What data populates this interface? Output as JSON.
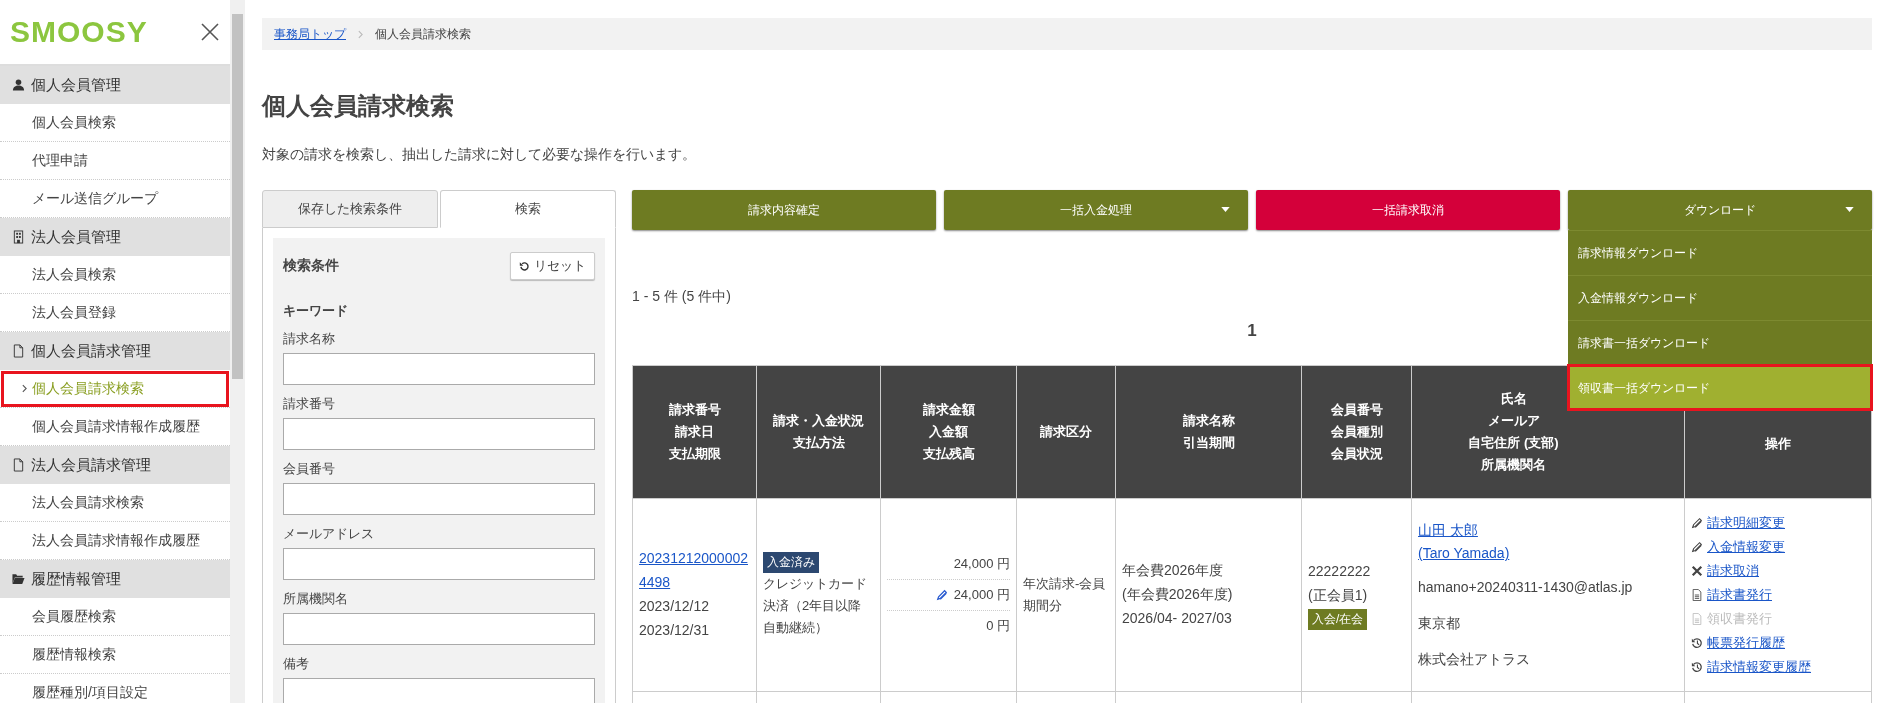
{
  "sidebar": {
    "logo": "SMOOSY",
    "sections": [
      {
        "title": "個人会員管理",
        "items": [
          {
            "label": "個人会員検索",
            "selected": false,
            "highlighted": false
          },
          {
            "label": "代理申請",
            "selected": false,
            "highlighted": false
          },
          {
            "label": "メール送信グループ",
            "selected": false,
            "highlighted": false
          }
        ]
      },
      {
        "title": "法人会員管理",
        "items": [
          {
            "label": "法人会員検索",
            "selected": false,
            "highlighted": false
          },
          {
            "label": "法人会員登録",
            "selected": false,
            "highlighted": false
          }
        ]
      },
      {
        "title": "個人会員請求管理",
        "items": [
          {
            "label": "個人会員請求検索",
            "selected": true,
            "highlighted": true
          },
          {
            "label": "個人会員請求情報作成履歴",
            "selected": false,
            "highlighted": false
          }
        ]
      },
      {
        "title": "法人会員請求管理",
        "items": [
          {
            "label": "法人会員請求検索",
            "selected": false,
            "highlighted": false
          },
          {
            "label": "法人会員請求情報作成履歴",
            "selected": false,
            "highlighted": false
          }
        ]
      },
      {
        "title": "履歴情報管理",
        "items": [
          {
            "label": "会員履歴検索",
            "selected": false,
            "highlighted": false
          },
          {
            "label": "履歴情報検索",
            "selected": false,
            "highlighted": false
          },
          {
            "label": "履歴種別/項目設定",
            "selected": false,
            "highlighted": false
          }
        ]
      }
    ]
  },
  "breadcrumb": [
    {
      "label": "事務局トップ",
      "kind": "link"
    },
    {
      "label": "個人会員請求検索",
      "kind": "current"
    }
  ],
  "page": {
    "title": "個人会員請求検索",
    "description": "対象の請求を検索し、抽出した請求に対して必要な操作を行います。"
  },
  "search_panel": {
    "tabs": [
      {
        "label": "保存した検索条件",
        "selected": false
      },
      {
        "label": "検索",
        "selected": true
      }
    ],
    "heading": "検索条件",
    "reset_button": "リセット",
    "group_label": "キーワード",
    "fields": [
      {
        "label": "請求名称"
      },
      {
        "label": "請求番号"
      },
      {
        "label": "会員番号"
      },
      {
        "label": "メールアドレス"
      },
      {
        "label": "所属機関名"
      },
      {
        "label": "備考"
      }
    ]
  },
  "actions": [
    {
      "label": "請求内容確定",
      "kind": "primary",
      "dropdown": false,
      "expanded": false
    },
    {
      "label": "一括入金処理",
      "kind": "primary",
      "dropdown": true,
      "expanded": false
    },
    {
      "label": "一括請求取消",
      "kind": "danger",
      "dropdown": false,
      "expanded": false
    },
    {
      "label": "ダウンロード",
      "kind": "primary",
      "dropdown": true,
      "expanded": true,
      "menu": [
        {
          "label": "請求情報ダウンロード",
          "selected": false,
          "highlighted": false
        },
        {
          "label": "入金情報ダウンロード",
          "selected": false,
          "highlighted": false
        },
        {
          "label": "請求書一括ダウンロード",
          "selected": false,
          "highlighted": false
        },
        {
          "label": "領収書一括ダウンロード",
          "selected": true,
          "highlighted": true
        }
      ]
    }
  ],
  "result_count": "1 - 5 件 (5 件中)",
  "pagination": [
    "1"
  ],
  "table": {
    "columns": [
      [
        "請求番号",
        "請求日",
        "支払期限"
      ],
      [
        "請求・入金状況",
        "支払方法"
      ],
      [
        "請求金額",
        "入金額",
        "支払残高"
      ],
      [
        "請求区分"
      ],
      [
        "請求名称",
        "引当期間"
      ],
      [
        "会員番号",
        "会員種別",
        "会員状況"
      ],
      [
        "氏名",
        "メールア",
        "自宅住所 (支部)",
        "所属機関名"
      ],
      [
        "操作"
      ]
    ],
    "rows": [
      {
        "invoice_number": "202312120000024498",
        "invoice_date": "2023/12/12",
        "due_date": "2023/12/31",
        "payment_status": "入金済み",
        "payment_method": "クレジットカード決済（2年目以降自動継続）",
        "amounts": [
          {
            "value": "24,000 円",
            "edited": false
          },
          {
            "value": "24,000 円",
            "edited": true
          },
          {
            "value": "0 円",
            "edited": false
          }
        ],
        "billing_type": "年次請求-会員期間分",
        "billing_name": [
          "年会費2026年度",
          "(年会費2026年度)",
          "2026/04- 2027/03"
        ],
        "member_number": "22222222",
        "member_type": "(正会員1)",
        "member_status": "入会/在会",
        "name": [
          "山田 太郎",
          "(Taro Yamada)"
        ],
        "email": "hamano+20240311-1430@atlas.jp",
        "address": "東京都",
        "organization": "株式会社アトラス",
        "operations": [
          {
            "label": "請求明細変更",
            "kind": "edit",
            "disabled": false
          },
          {
            "label": "入金情報変更",
            "kind": "edit",
            "disabled": false
          },
          {
            "label": "請求取消",
            "kind": "cancel",
            "disabled": false
          },
          {
            "label": "請求書発行",
            "kind": "document",
            "disabled": false
          },
          {
            "label": "領収書発行",
            "kind": "document",
            "disabled": true
          },
          {
            "label": "帳票発行履歴",
            "kind": "history",
            "disabled": false
          },
          {
            "label": "請求情報変更履歴",
            "kind": "history",
            "disabled": false
          }
        ]
      }
    ]
  }
}
